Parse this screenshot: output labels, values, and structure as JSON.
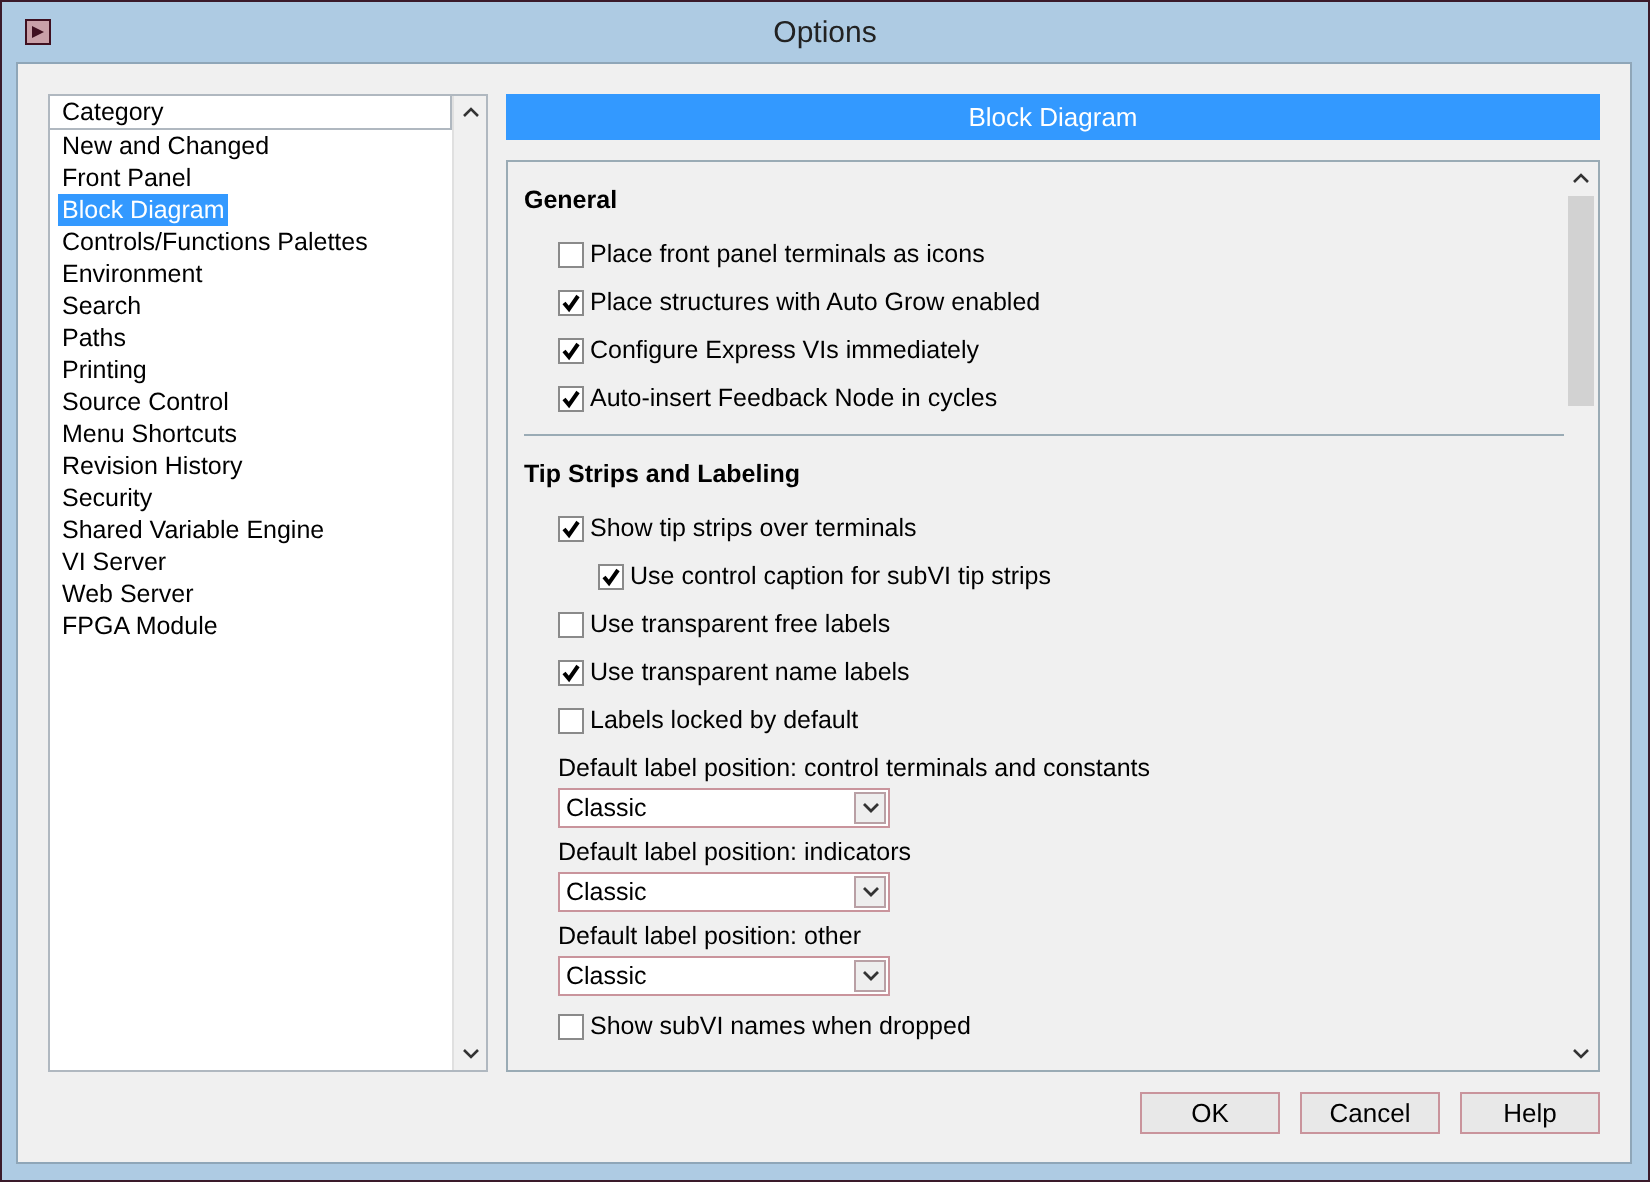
{
  "window": {
    "title": "Options"
  },
  "category_list": {
    "header": "Category",
    "items": [
      {
        "label": "New and Changed",
        "selected": false
      },
      {
        "label": "Front Panel",
        "selected": false
      },
      {
        "label": "Block Diagram",
        "selected": true
      },
      {
        "label": "Controls/Functions Palettes",
        "selected": false
      },
      {
        "label": "Environment",
        "selected": false
      },
      {
        "label": "Search",
        "selected": false
      },
      {
        "label": "Paths",
        "selected": false
      },
      {
        "label": "Printing",
        "selected": false
      },
      {
        "label": "Source Control",
        "selected": false
      },
      {
        "label": "Menu Shortcuts",
        "selected": false
      },
      {
        "label": "Revision History",
        "selected": false
      },
      {
        "label": "Security",
        "selected": false
      },
      {
        "label": "Shared Variable Engine",
        "selected": false
      },
      {
        "label": "VI Server",
        "selected": false
      },
      {
        "label": "Web Server",
        "selected": false
      },
      {
        "label": "FPGA Module",
        "selected": false
      }
    ]
  },
  "panel": {
    "title": "Block Diagram",
    "sections": [
      {
        "heading": "General",
        "options": [
          {
            "kind": "checkbox",
            "label": "Place front panel terminals as icons",
            "checked": false
          },
          {
            "kind": "checkbox",
            "label": "Place structures with Auto Grow enabled",
            "checked": true
          },
          {
            "kind": "checkbox",
            "label": "Configure Express VIs immediately",
            "checked": true
          },
          {
            "kind": "checkbox",
            "label": "Auto-insert Feedback Node in cycles",
            "checked": true
          }
        ]
      },
      {
        "heading": "Tip Strips and Labeling",
        "options": [
          {
            "kind": "checkbox",
            "label": "Show tip strips over terminals",
            "checked": true,
            "children": [
              {
                "kind": "checkbox",
                "label": "Use control caption for subVI tip strips",
                "checked": true
              }
            ]
          },
          {
            "kind": "checkbox",
            "label": "Use transparent free labels",
            "checked": false
          },
          {
            "kind": "checkbox",
            "label": "Use transparent name labels",
            "checked": true
          },
          {
            "kind": "checkbox",
            "label": "Labels locked by default",
            "checked": false
          },
          {
            "kind": "dropdown",
            "label": "Default label position: control terminals and constants",
            "value": "Classic"
          },
          {
            "kind": "dropdown",
            "label": "Default label position: indicators",
            "value": "Classic"
          },
          {
            "kind": "dropdown",
            "label": "Default label position: other",
            "value": "Classic"
          },
          {
            "kind": "checkbox",
            "label": "Show subVI names when dropped",
            "checked": false
          }
        ]
      }
    ]
  },
  "buttons": [
    "OK",
    "Cancel",
    "Help"
  ]
}
